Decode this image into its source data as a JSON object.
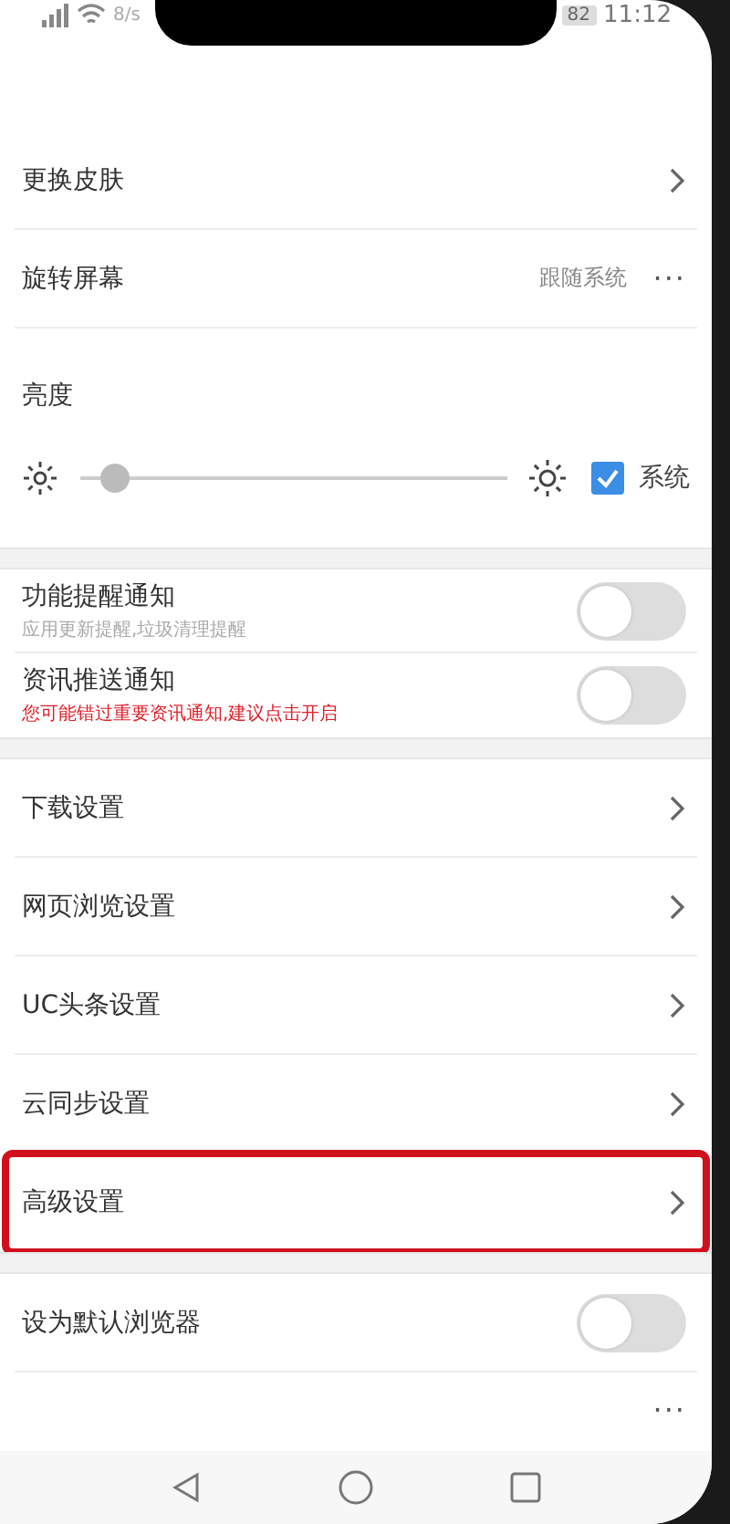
{
  "status_bar": {
    "speed": "8/s",
    "battery": "82",
    "time": "11:12"
  },
  "sections": [
    {
      "items": [
        {
          "kind": "link",
          "label": "更换皮肤",
          "highlighted": false
        },
        {
          "kind": "option",
          "label": "旋转屏幕",
          "value": "跟随系统",
          "more": "···"
        },
        {
          "kind": "brightness",
          "label": "亮度",
          "level": 0.08,
          "follow_label": "系统",
          "checked": true
        }
      ]
    },
    {
      "items": [
        {
          "kind": "toggle",
          "label": "功能提醒通知",
          "subtitle": "应用更新提醒,垃圾清理提醒",
          "warning": false,
          "on": false
        },
        {
          "kind": "toggle",
          "label": "资讯推送通知",
          "subtitle": "您可能错过重要资讯通知,建议点击开启",
          "warning": true,
          "on": false
        }
      ]
    },
    {
      "items": [
        {
          "kind": "link",
          "label": "下载设置",
          "highlighted": false
        },
        {
          "kind": "link",
          "label": "网页浏览设置",
          "highlighted": false
        },
        {
          "kind": "link",
          "label": "UC头条设置",
          "highlighted": false
        },
        {
          "kind": "link",
          "label": "云同步设置",
          "highlighted": false
        },
        {
          "kind": "link",
          "label": "高级设置",
          "highlighted": true
        }
      ]
    },
    {
      "items": [
        {
          "kind": "toggle",
          "label": "设为默认浏览器",
          "on": false
        },
        {
          "kind": "cut",
          "more": "···"
        }
      ]
    }
  ]
}
